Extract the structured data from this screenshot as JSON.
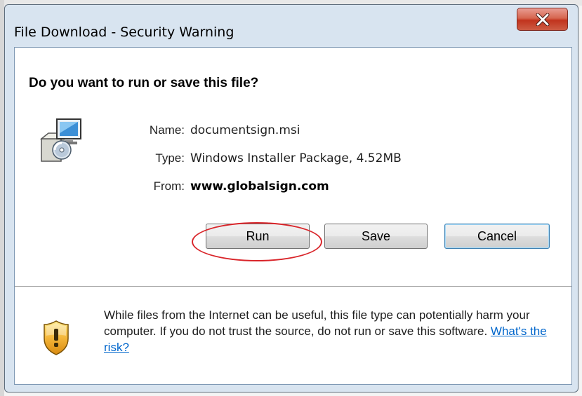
{
  "window": {
    "title": "File Download - Security Warning",
    "close_label": "Close"
  },
  "dialog": {
    "question": "Do you want to run or save this file?",
    "file": {
      "name_label": "Name:",
      "name": "documentsign.msi",
      "type_label": "Type:",
      "type": "Windows Installer Package, 4.52MB",
      "from_label": "From:",
      "from": "www.globalsign.com"
    },
    "buttons": {
      "run": "Run",
      "save": "Save",
      "cancel": "Cancel"
    },
    "warning": {
      "text": "While files from the Internet can be useful, this file type can potentially harm your computer. If you do not trust the source, do not run or save this software.",
      "link": "What's the risk?"
    }
  },
  "colors": {
    "close_button": "#c7432c",
    "highlight_ellipse": "#d9252a",
    "link": "#0066cc"
  },
  "icons": {
    "package": "installer-package-icon",
    "warning": "security-shield-icon",
    "close": "close-x-icon"
  }
}
